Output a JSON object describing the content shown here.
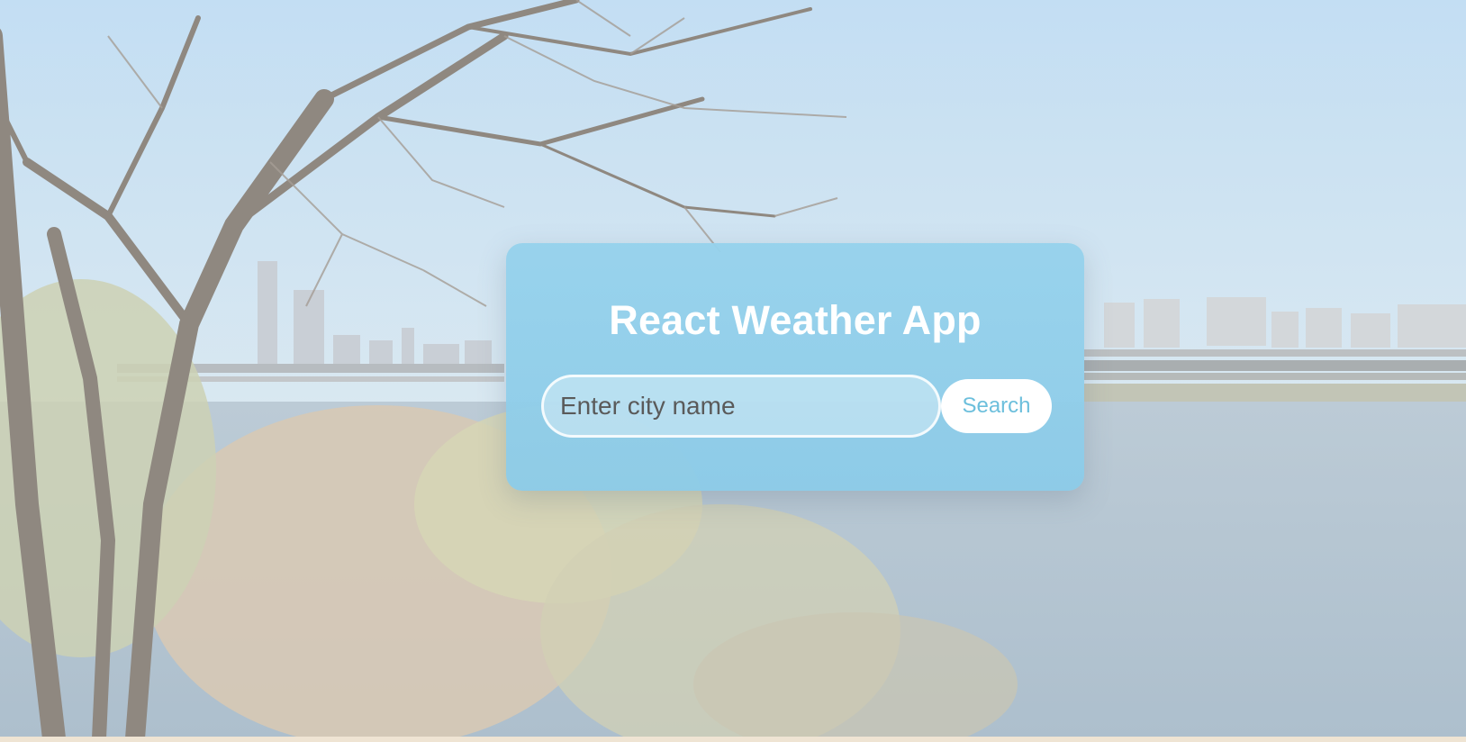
{
  "app": {
    "title": "React Weather App"
  },
  "search": {
    "placeholder": "Enter city name",
    "value": "",
    "button_label": "Search"
  },
  "colors": {
    "card_background": "#92d1ec",
    "title_text": "#ffffff",
    "button_background": "#ffffff",
    "button_text": "#6cbfdc",
    "sky": "#c4e0f4",
    "river": "#b4c8d8"
  },
  "icons": {
    "background": "riverside-city-photo"
  }
}
